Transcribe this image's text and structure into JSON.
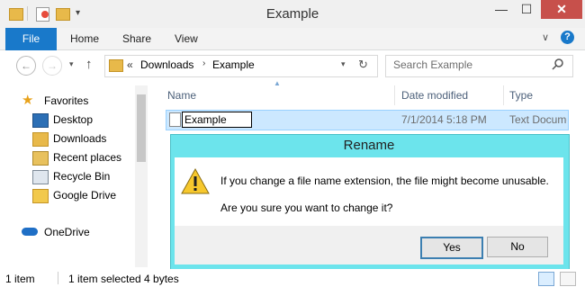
{
  "window": {
    "title": "Example",
    "controls": {
      "minimize": "—",
      "maximize": "☐",
      "close": "✕"
    }
  },
  "ribbon": {
    "tabs": [
      "File",
      "Home",
      "Share",
      "View"
    ]
  },
  "address": {
    "path": [
      "Downloads",
      "Example"
    ],
    "overflow": "«",
    "search_placeholder": "Search Example"
  },
  "nav": {
    "favorites": "Favorites",
    "items": [
      "Desktop",
      "Downloads",
      "Recent places",
      "Recycle Bin",
      "Google Drive"
    ],
    "onedrive": "OneDrive"
  },
  "list": {
    "columns": [
      "Name",
      "Date modified",
      "Type"
    ],
    "rows": [
      {
        "name": "Example",
        "date": "7/1/2014 5:18 PM",
        "type": "Text Documen"
      }
    ]
  },
  "status": {
    "count": "1 item",
    "selection": "1 item selected 4 bytes"
  },
  "dialog": {
    "title": "Rename",
    "message": "If you change a file name extension, the file might become unusable.",
    "question": "Are you sure you want to change it?",
    "yes": "Yes",
    "no": "No"
  },
  "colors": {
    "file_tab": "#1979ca",
    "dialog_frame": "#6ce4ec",
    "selection": "#cce8ff",
    "close": "#c7504b"
  }
}
